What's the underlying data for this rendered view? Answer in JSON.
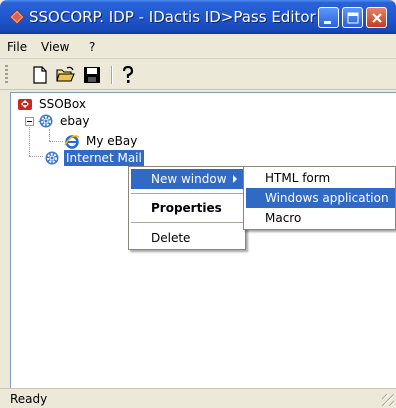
{
  "window": {
    "title": "SSOCORP. IDP - IDactis ID>Pass Editor",
    "icon": "diamond-app-icon"
  },
  "title_buttons": {
    "minimize": "minimize-icon",
    "maximize": "maximize-icon",
    "close": "close-icon"
  },
  "menubar": {
    "items": [
      "File",
      "View",
      "?"
    ]
  },
  "toolbar": {
    "icons": [
      "new-document-icon",
      "open-folder-icon",
      "save-disk-icon",
      "help-question-icon"
    ]
  },
  "tree": {
    "nodes": [
      {
        "label": "SSOBox",
        "icon": "ssobox-icon",
        "level": 0
      },
      {
        "label": "ebay",
        "icon": "gear-icon",
        "level": 1,
        "expanded": true
      },
      {
        "label": "My eBay",
        "icon": "internet-explorer-icon",
        "level": 2
      },
      {
        "label": "Internet Mail",
        "icon": "gear-icon",
        "level": 1,
        "selected": true
      }
    ]
  },
  "context_menu": {
    "items": [
      {
        "label": "New window",
        "highlighted": true,
        "has_submenu": true
      },
      {
        "label": "Properties",
        "bold": true
      },
      {
        "label": "Delete"
      }
    ]
  },
  "submenu": {
    "items": [
      {
        "label": "HTML form"
      },
      {
        "label": "Windows application",
        "highlighted": true
      },
      {
        "label": "Macro"
      }
    ]
  },
  "statusbar": {
    "text": "Ready"
  },
  "colors": {
    "title_blue": "#1f57cf",
    "selection": "#316ac5",
    "window_face": "#ece9d8",
    "close_red": "#c53c1c"
  }
}
